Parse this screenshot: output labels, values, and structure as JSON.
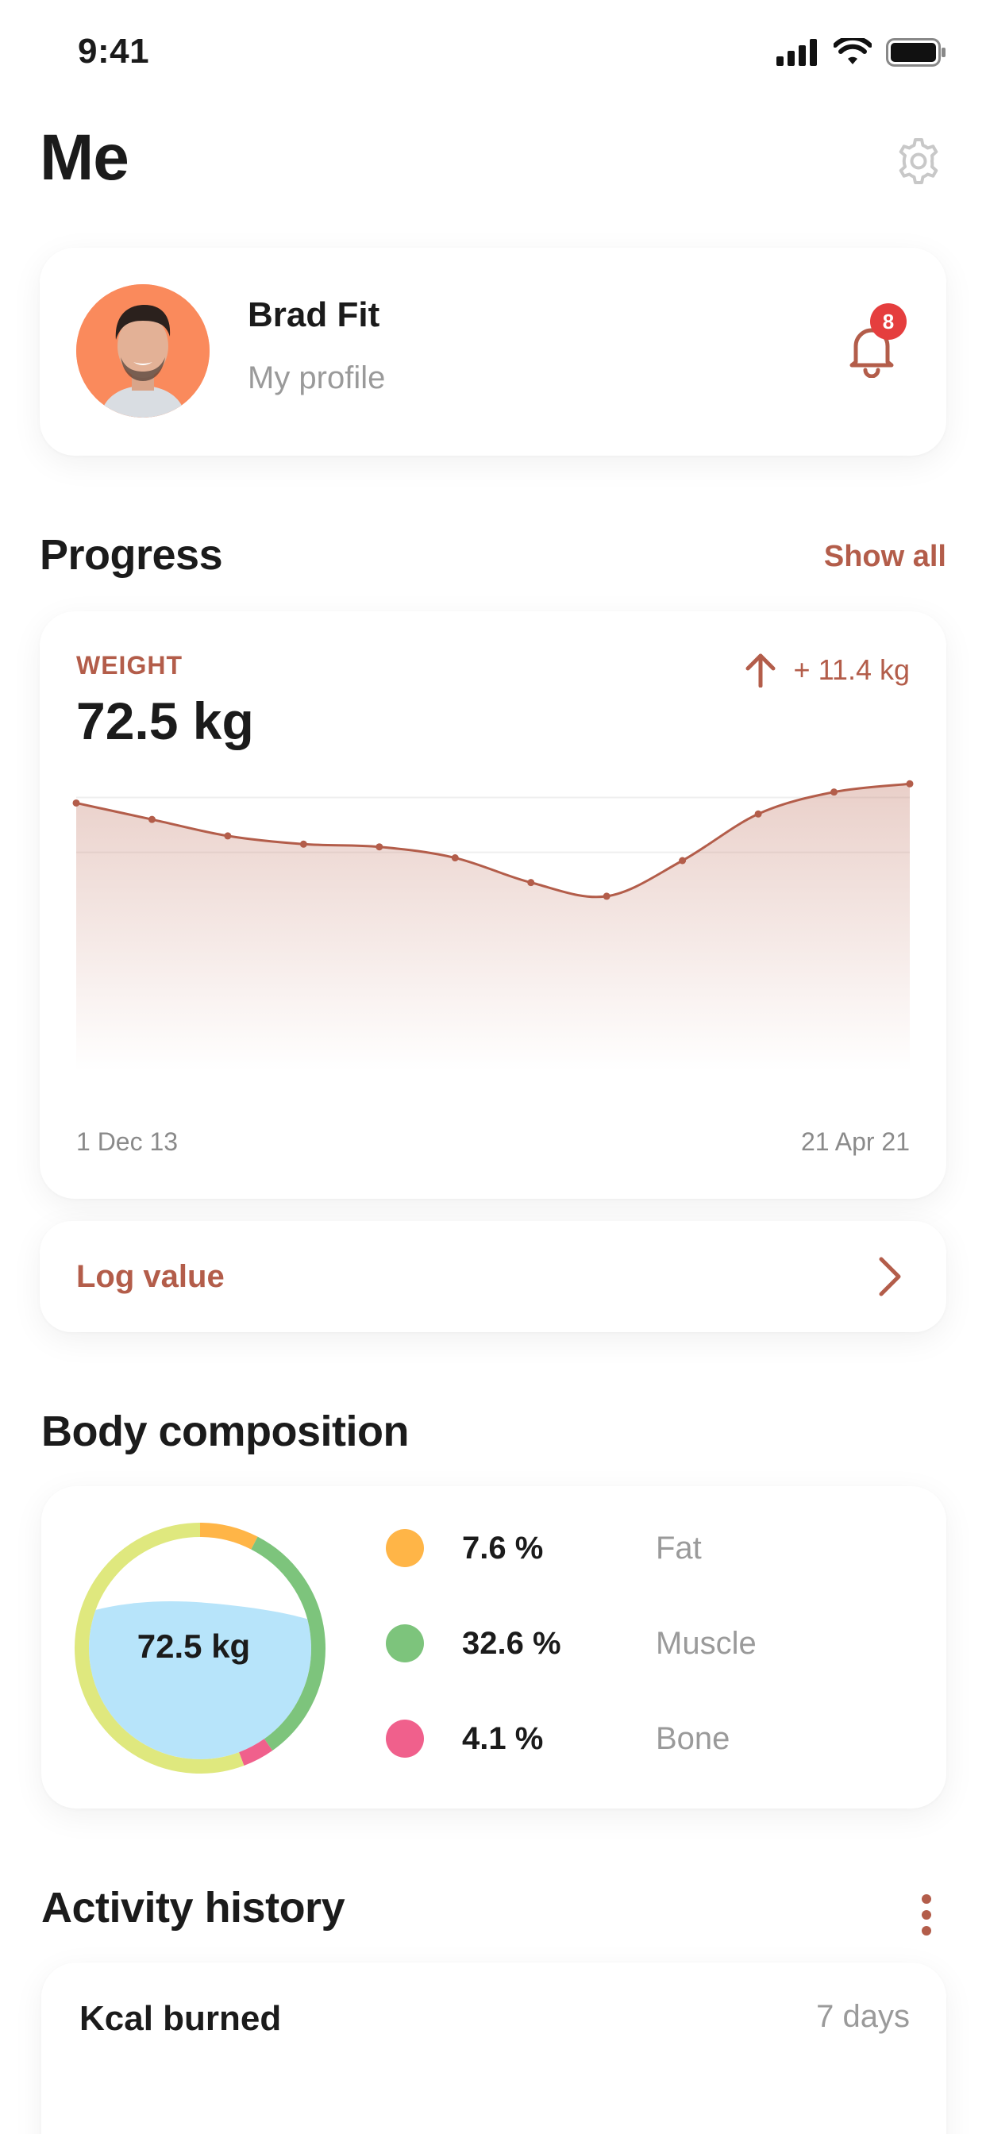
{
  "status_bar": {
    "time": "9:41"
  },
  "header": {
    "title": "Me"
  },
  "profile": {
    "name": "Brad Fit",
    "subtitle": "My profile",
    "notification_count": "8"
  },
  "progress": {
    "section_title": "Progress",
    "show_all_label": "Show all",
    "metric_label": "WEIGHT",
    "metric_value": "72.5 kg",
    "change": "+ 11.4 kg",
    "start_date": "1 Dec 13",
    "end_date": "21 Apr 21",
    "log_label": "Log value"
  },
  "chart_data": {
    "type": "area",
    "series": [
      {
        "values": [
          71.8,
          71.2,
          70.6,
          70.3,
          70.2,
          69.8,
          68.9,
          68.4,
          69.7,
          71.4,
          72.2,
          72.5
        ]
      }
    ],
    "x": [
      "1 Dec 13",
      "",
      "",
      "",
      "",
      "",
      "",
      "",
      "",
      "",
      "",
      "21 Apr 21"
    ],
    "ylim": [
      62,
      73
    ],
    "grid": "horizontal",
    "color": "#b35d4a"
  },
  "composition": {
    "section_title": "Body composition",
    "center_label": "72.5 kg",
    "items": [
      {
        "value": "7.6 %",
        "name": "Fat",
        "color": "#ffb547"
      },
      {
        "value": "32.6 %",
        "name": "Muscle",
        "color": "#7dc47c"
      },
      {
        "value": "4.1 %",
        "name": "Bone",
        "color": "#f0608c"
      }
    ],
    "ring_other_color": "#dfe87e",
    "water_color": "#b7e4fa"
  },
  "activity": {
    "section_title": "Activity history",
    "card_title": "Kcal burned",
    "range": "7 days"
  },
  "colors": {
    "accent": "#b35d4a",
    "badge": "#e53e3e"
  }
}
